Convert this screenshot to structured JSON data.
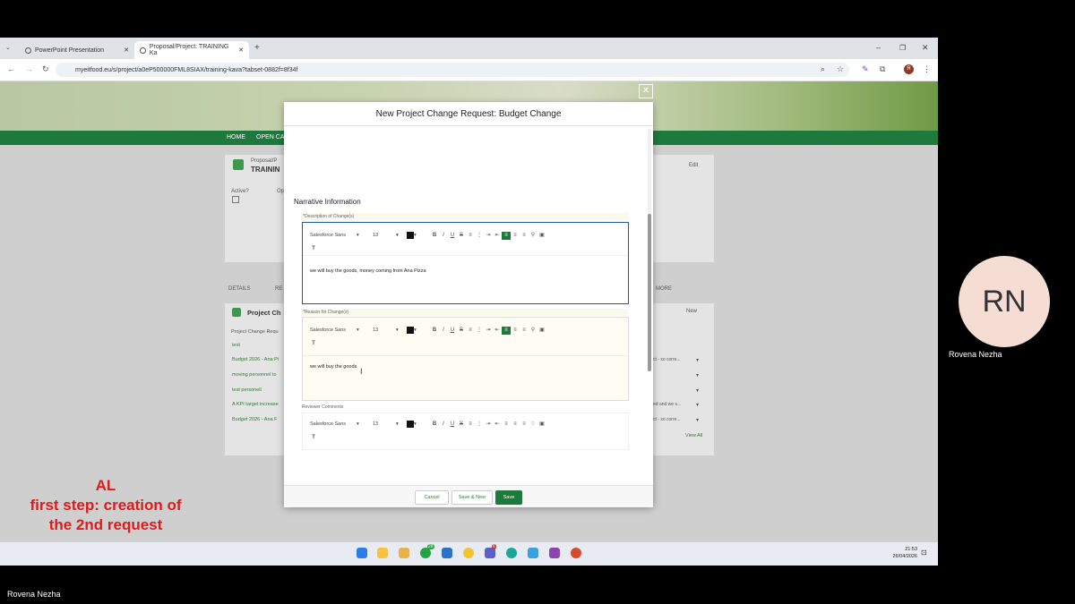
{
  "browser": {
    "tabs": [
      {
        "label": "PowerPoint Presentation"
      },
      {
        "label": "Proposal/Project: TRAINING Ka"
      }
    ],
    "url": "myeitfood.eu/s/project/a0eP500000FML8SIAX/training-kava?tabset-0882f=8f34f",
    "profile_initial": "R"
  },
  "site": {
    "nav_items": [
      "HOME",
      "OPEN CA"
    ],
    "record_type": "Proposal/P",
    "record_name": "TRAININ",
    "active_label": "Active?",
    "other_label": "Op",
    "edit_label": "Edit",
    "tabs": [
      "DETAILS",
      "RE"
    ],
    "more_label": "MORE",
    "related_title": "Project Ch",
    "new_label": "New",
    "col_header": "Project Change Requ",
    "rows": [
      "test",
      "Budget 2026 - Ana Pi",
      "moving personnel to",
      "test personell",
      "A KPI target increase",
      "Budget 2026 - Ana F"
    ],
    "right_rows": [
      "ct - so corre...",
      "",
      "",
      "ed and we s...",
      "ct - so corre..."
    ],
    "view_all": "View All"
  },
  "modal": {
    "title": "New Project Change Request: Budget Change",
    "section_title": "Narrative Information",
    "fields": [
      {
        "label": "*Description of Change(s)",
        "font": "Salesforce Sans",
        "size": "13",
        "text": "we will buy the goods, money coming from Ana Pizza"
      },
      {
        "label": "*Reason for Change(s)",
        "font": "Salesforce Sans",
        "size": "13",
        "text": "we will buy the goods"
      },
      {
        "label": "Reviewer Comments",
        "font": "Salesforce Sans",
        "size": "13",
        "text": ""
      }
    ],
    "buttons": {
      "cancel": "Cancel",
      "save_new": "Save & New",
      "save": "Save"
    }
  },
  "taskbar": {
    "time": "21:53",
    "date": "26/04/2026",
    "whatsapp_badge": "28",
    "teams_badge": "6"
  },
  "participant": {
    "initials": "RN",
    "name": "Rovena Nezha"
  },
  "footer_name": "Rovena Nezha",
  "caption": {
    "line1": "AL",
    "line2": "first step: creation of",
    "line3": "the 2nd request"
  }
}
